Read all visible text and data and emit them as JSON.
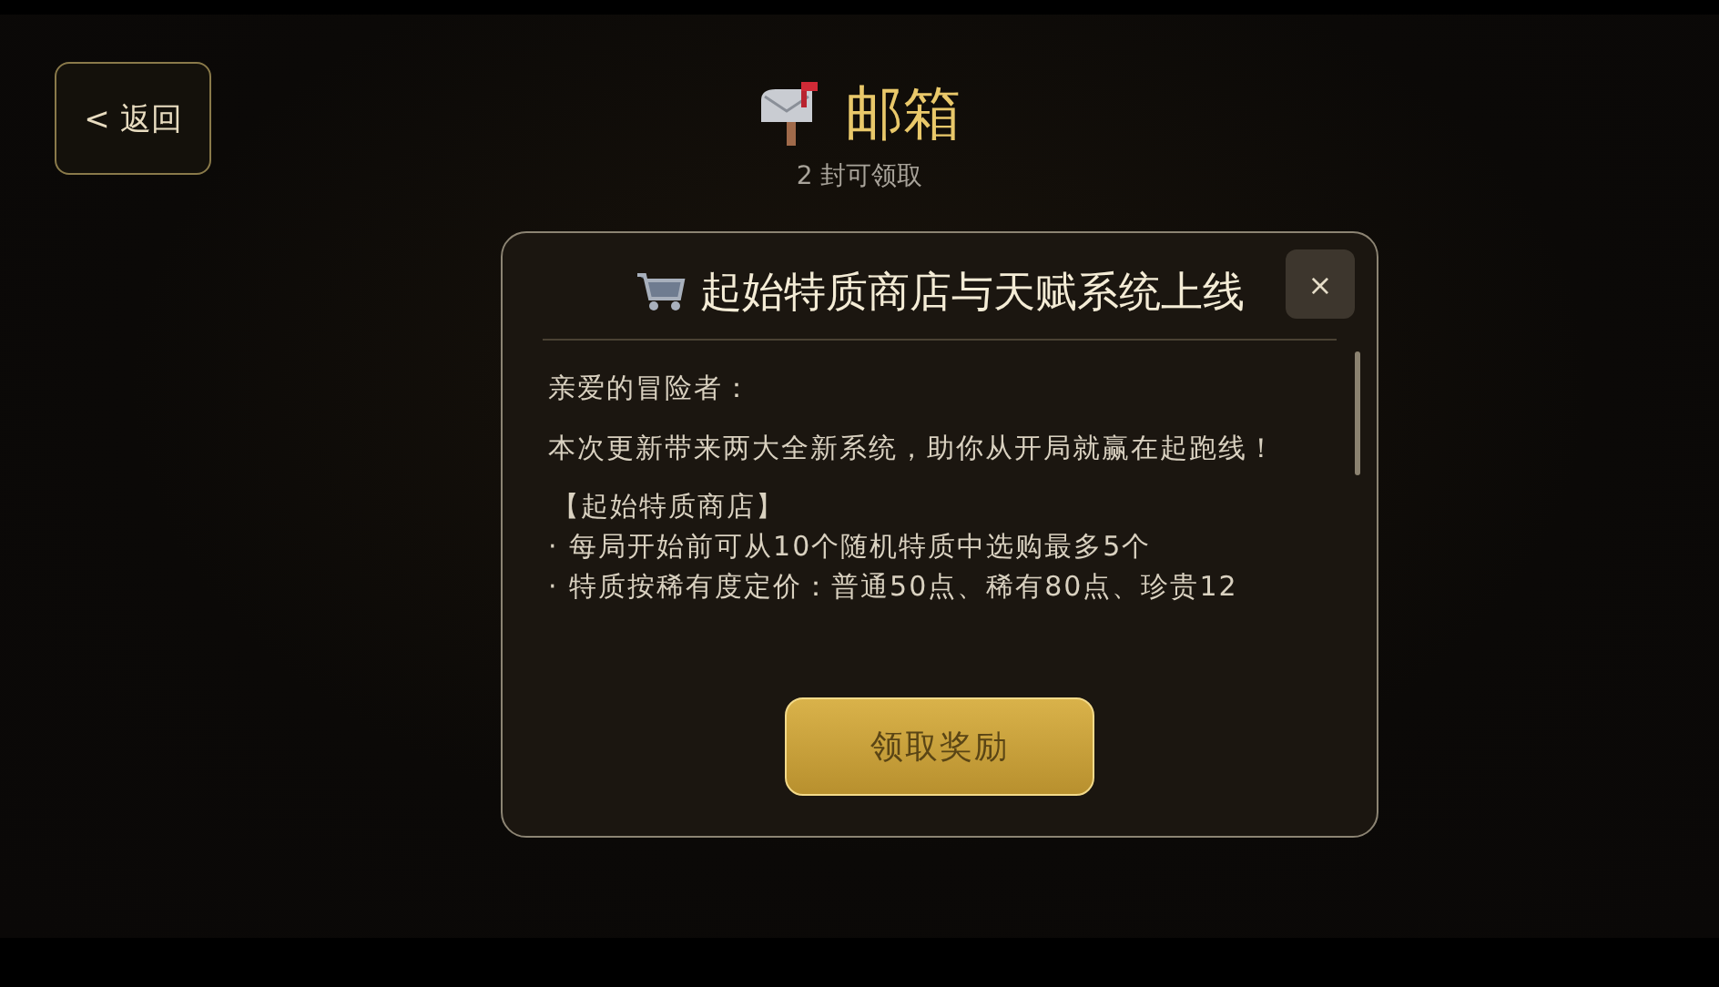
{
  "header": {
    "back_button": "< 返回",
    "title": "邮箱",
    "subtitle": "2 封可领取"
  },
  "mail": {
    "title": "起始特质商店与天赋系统上线",
    "close": "×",
    "body": [
      {
        "kind": "paragraph",
        "text": "亲爱的冒险者："
      },
      {
        "kind": "paragraph",
        "text": "本次更新带来两大全新系统，助你从开局就赢在起跑线！"
      },
      {
        "kind": "heading",
        "text": "【起始特质商店】"
      },
      {
        "kind": "bullet",
        "text": "· 每局开始前可从10个随机特质中选购最多5个"
      },
      {
        "kind": "bullet",
        "text": "· 特质按稀有度定价：普通50点、稀有80点、珍贵12"
      }
    ],
    "claim_button": "领取奖励"
  }
}
